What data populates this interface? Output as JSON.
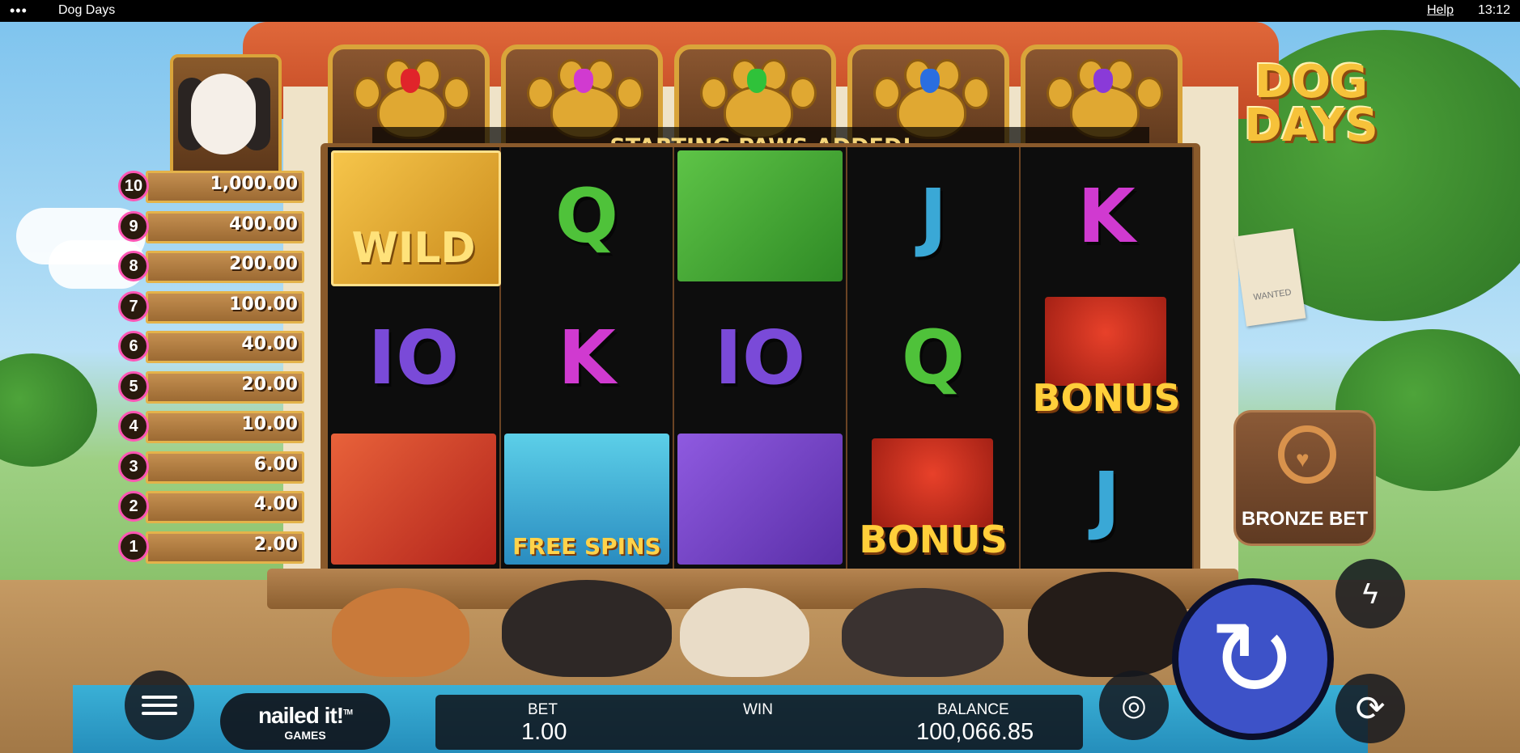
{
  "topbar": {
    "menu_dots": "•••",
    "title": "Dog Days",
    "help": "Help",
    "time": "13:12"
  },
  "game": {
    "logo_line1": "DOG",
    "logo_line2": "DAYS",
    "banner": "STARTING PAWS ADDED!",
    "paw_gems": [
      "#e0242a",
      "#d13ad0",
      "#2fc23a",
      "#2a6ee0",
      "#8a3ad8"
    ],
    "ladder": [
      {
        "level": "10",
        "value": "1,000.00"
      },
      {
        "level": "9",
        "value": "400.00"
      },
      {
        "level": "8",
        "value": "200.00"
      },
      {
        "level": "7",
        "value": "100.00"
      },
      {
        "level": "6",
        "value": "40.00"
      },
      {
        "level": "5",
        "value": "20.00"
      },
      {
        "level": "4",
        "value": "10.00"
      },
      {
        "level": "3",
        "value": "6.00"
      },
      {
        "level": "2",
        "value": "4.00"
      },
      {
        "level": "1",
        "value": "2.00"
      }
    ],
    "reels": [
      [
        {
          "kind": "wild",
          "label": "WILD"
        },
        {
          "kind": "ten",
          "label": "IO"
        },
        {
          "kind": "woman",
          "label": ""
        }
      ],
      [
        {
          "kind": "q",
          "label": "Q"
        },
        {
          "kind": "k",
          "label": "K"
        },
        {
          "kind": "free",
          "label": "FREE SPINS"
        }
      ],
      [
        {
          "kind": "bowl",
          "label": ""
        },
        {
          "kind": "ten",
          "label": "IO"
        },
        {
          "kind": "collar",
          "label": ""
        }
      ],
      [
        {
          "kind": "j",
          "label": "J"
        },
        {
          "kind": "q",
          "label": "Q"
        },
        {
          "kind": "bonus",
          "label": "BONUS"
        }
      ],
      [
        {
          "kind": "k",
          "label": "K"
        },
        {
          "kind": "bonus",
          "label": "BONUS"
        },
        {
          "kind": "j",
          "label": "J"
        }
      ]
    ],
    "wanted_note": "WANTED",
    "bronze_bet": "BRONZE BET"
  },
  "footer": {
    "brand_line1": "nailed it!",
    "brand_trademark": "TM",
    "brand_line2": "GAMES",
    "bet_label": "BET",
    "bet_value": "1.00",
    "win_label": "WIN",
    "win_value": "",
    "balance_label": "BALANCE",
    "balance_value": "100,066.85"
  },
  "icons": [
    "menu-icon",
    "coins-icon",
    "spin-icon",
    "turbo-icon",
    "autoplay-icon",
    "heart-icon"
  ],
  "colors": {
    "spin_button": "#3d52c8",
    "ladder_badge": "#ff55b4",
    "gold": "#f6c23a"
  }
}
